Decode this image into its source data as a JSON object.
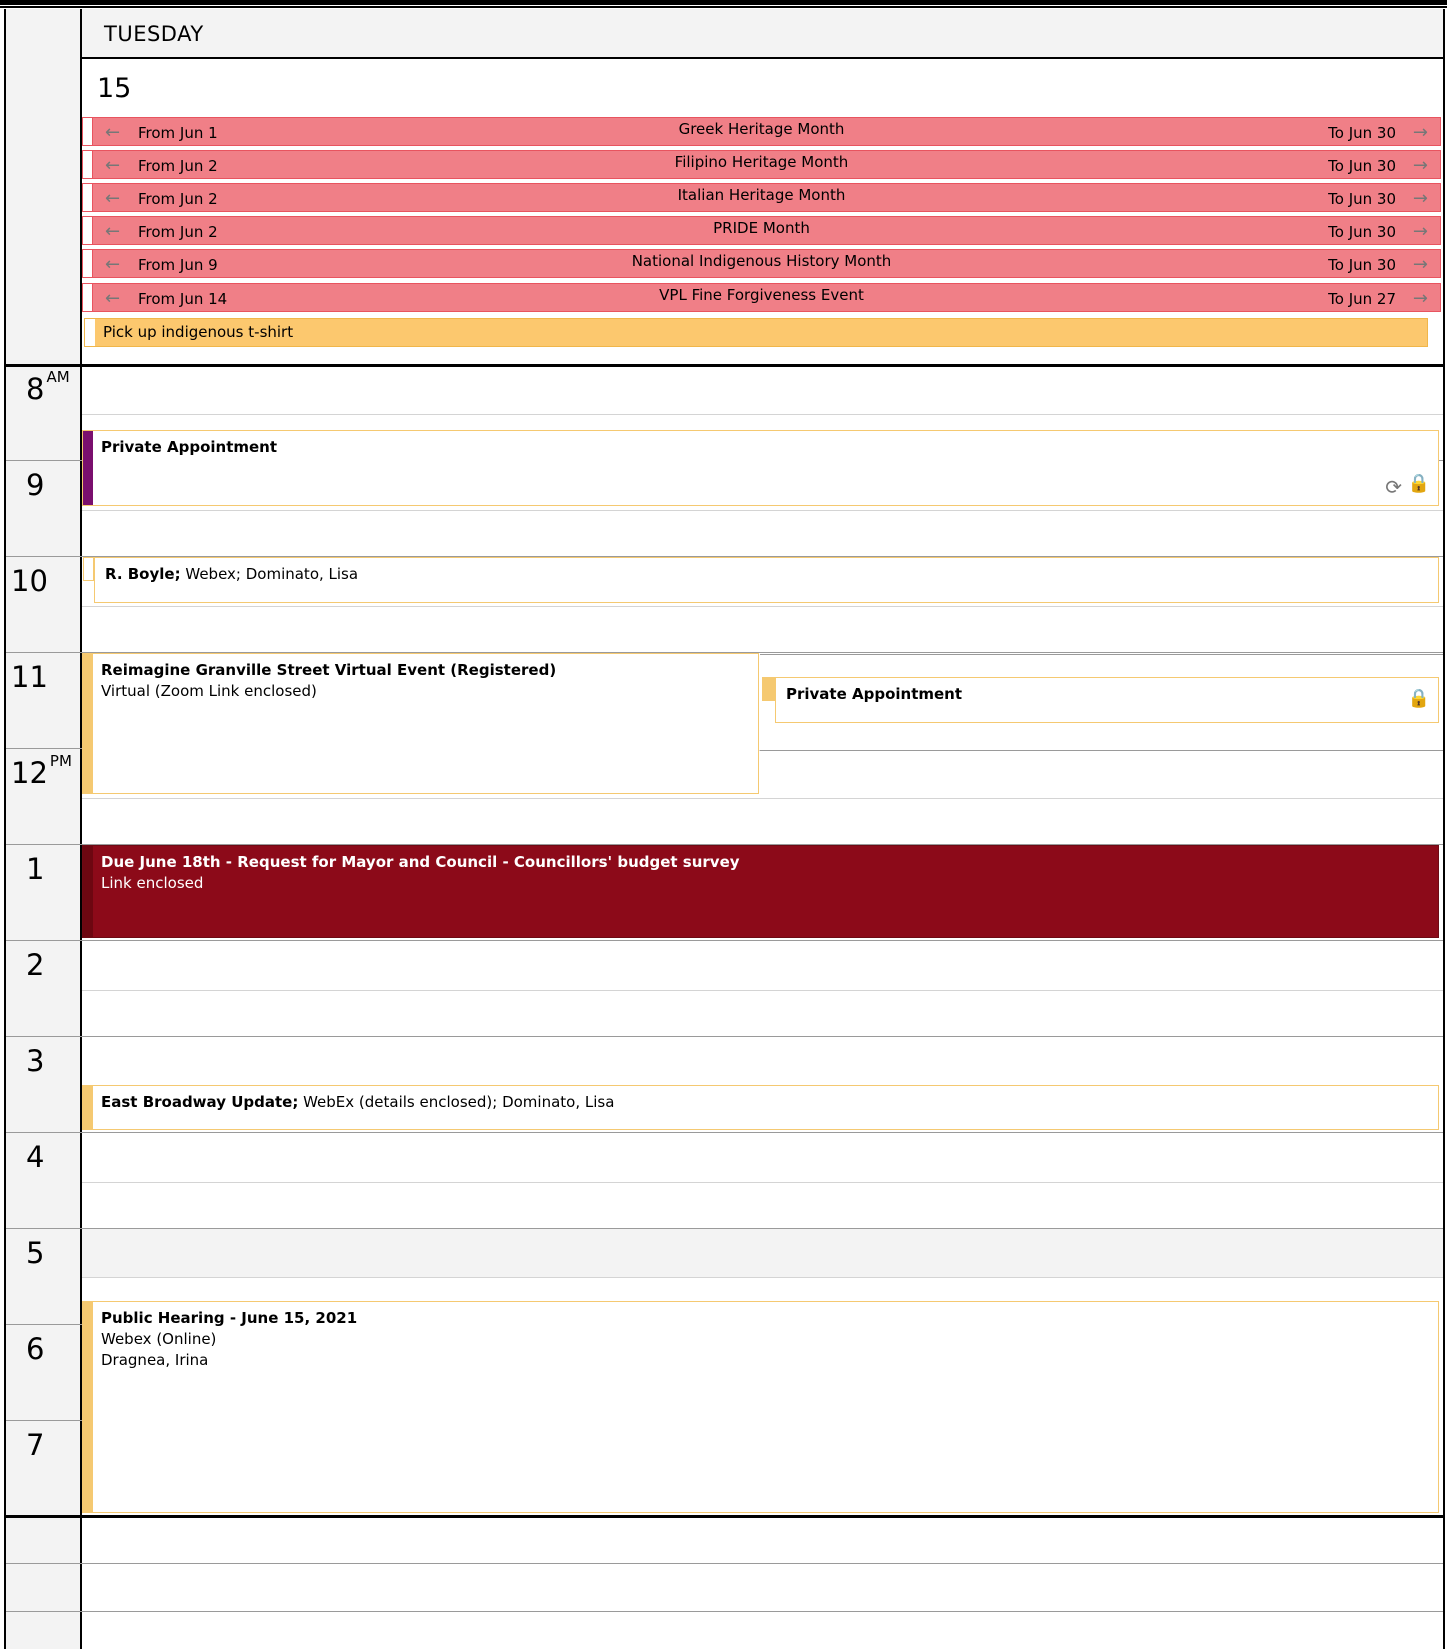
{
  "day": {
    "name": "TUESDAY",
    "number": "15"
  },
  "allday_events": [
    {
      "from": "From Jun 1",
      "title": "Greek Heritage Month",
      "to": "To Jun 30"
    },
    {
      "from": "From Jun 2",
      "title": "Filipino Heritage Month",
      "to": "To Jun 30"
    },
    {
      "from": "From Jun 2",
      "title": "Italian Heritage Month",
      "to": "To Jun 30"
    },
    {
      "from": "From Jun 2",
      "title": "PRIDE Month",
      "to": "To Jun 30"
    },
    {
      "from": "From Jun 9",
      "title": "National Indigenous History Month",
      "to": "To Jun 30"
    },
    {
      "from": "From Jun 14",
      "title": "VPL Fine Forgiveness Event",
      "to": "To Jun 27"
    }
  ],
  "task": {
    "title": "Pick up indigenous t-shirt"
  },
  "hours": [
    {
      "h": "8",
      "ampm": "AM"
    },
    {
      "h": "9",
      "ampm": ""
    },
    {
      "h": "10",
      "ampm": ""
    },
    {
      "h": "11",
      "ampm": ""
    },
    {
      "h": "12",
      "ampm": "PM"
    },
    {
      "h": "1",
      "ampm": ""
    },
    {
      "h": "2",
      "ampm": ""
    },
    {
      "h": "3",
      "ampm": ""
    },
    {
      "h": "4",
      "ampm": ""
    },
    {
      "h": "5",
      "ampm": ""
    },
    {
      "h": "6",
      "ampm": ""
    },
    {
      "h": "7",
      "ampm": ""
    }
  ],
  "appointments": {
    "private1": {
      "title": "Private Appointment"
    },
    "boyle": {
      "title": "R. Boyle;",
      "detail": " Webex; Dominato, Lisa"
    },
    "granville": {
      "title": "Reimagine Granville Street Virtual Event (Registered)",
      "line2": "Virtual (Zoom Link enclosed)"
    },
    "private2": {
      "title": "Private Appointment"
    },
    "budget": {
      "title": "Due June 18th - Request for Mayor and Council - Councillors' budget survey",
      "line2": "Link enclosed"
    },
    "broadway": {
      "title": "East Broadway Update;",
      "detail": " WebEx (details enclosed); Dominato, Lisa"
    },
    "hearing": {
      "title": "Public Hearing - June 15, 2021",
      "line2": "Webex (Online)",
      "line3": "Dragnea, Irina"
    }
  },
  "icons": {
    "arrow_left": "←",
    "arrow_right": "→",
    "recurring": "⟳",
    "lock": "🔒"
  },
  "colors": {
    "allday_fill": "#f07f87",
    "task_fill": "#fcc86e",
    "busy_border": "#f5c971",
    "deadline_fill": "#8c0a19",
    "private_bar": "#7a0f6e"
  }
}
